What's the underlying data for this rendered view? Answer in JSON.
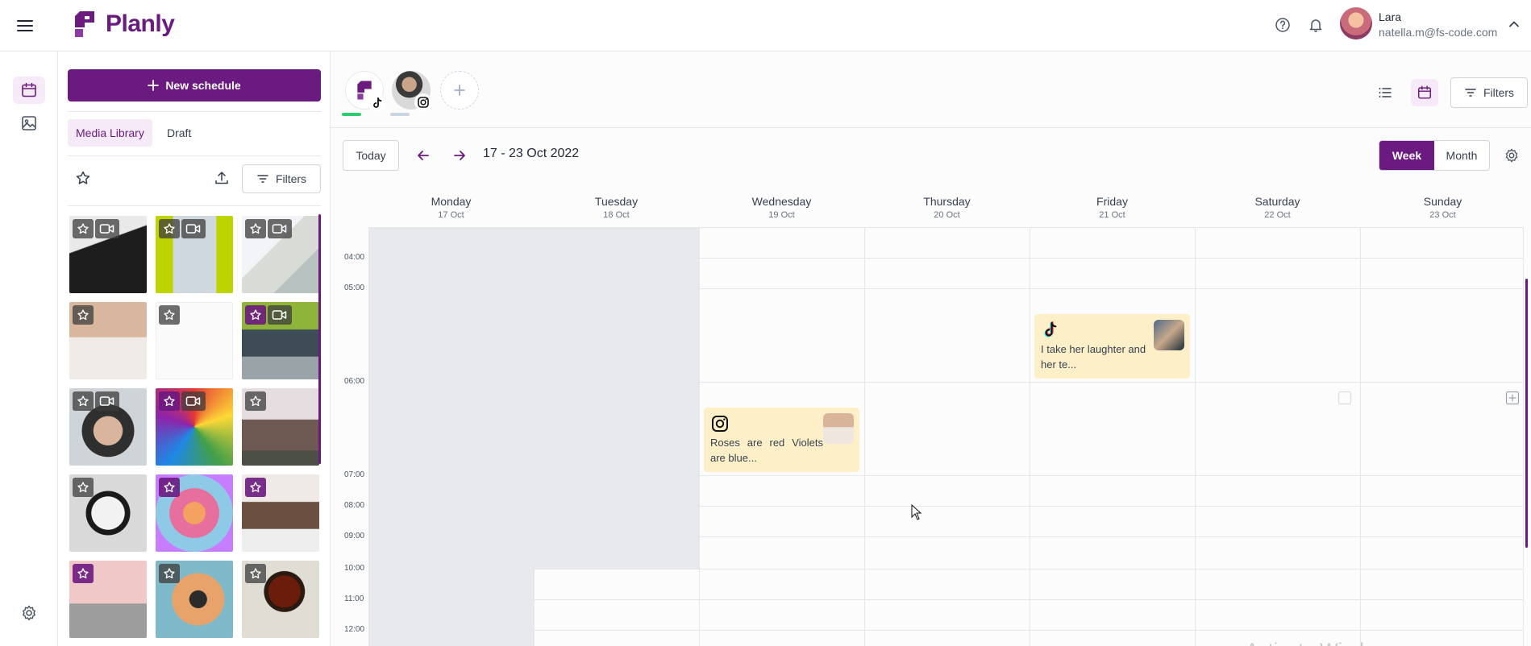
{
  "app": {
    "name": "Planly"
  },
  "user": {
    "name": "Lara",
    "email": "natella.m@fs-code.com"
  },
  "colors": {
    "brand": "#6b1a7f",
    "brand_light": "#f6eaf8",
    "post_bg": "#fdf0c8",
    "past_bg": "#e8e9ec"
  },
  "library": {
    "new_schedule_label": "New schedule",
    "tabs": [
      {
        "label": "Media Library",
        "active": true
      },
      {
        "label": "Draft",
        "active": false
      }
    ],
    "filters_label": "Filters",
    "items": [
      {
        "type": "video",
        "fav": false
      },
      {
        "type": "video",
        "fav": false
      },
      {
        "type": "video",
        "fav": false
      },
      {
        "type": "image",
        "fav": false
      },
      {
        "type": "image",
        "fav": false
      },
      {
        "type": "video",
        "fav": true
      },
      {
        "type": "video",
        "fav": false
      },
      {
        "type": "video",
        "fav": true
      },
      {
        "type": "image",
        "fav": false
      },
      {
        "type": "image",
        "fav": false
      },
      {
        "type": "image",
        "fav": true
      },
      {
        "type": "image",
        "fav": true
      },
      {
        "type": "image",
        "fav": true
      },
      {
        "type": "image",
        "fav": false
      },
      {
        "type": "image",
        "fav": false
      }
    ]
  },
  "toolbar": {
    "today_label": "Today",
    "range": "17 - 23 Oct 2022",
    "view_week": "Week",
    "view_month": "Month",
    "filters_label": "Filters"
  },
  "calendar": {
    "days": [
      {
        "name": "Monday",
        "date": "17 Oct"
      },
      {
        "name": "Tuesday",
        "date": "18 Oct"
      },
      {
        "name": "Wednesday",
        "date": "19 Oct"
      },
      {
        "name": "Thursday",
        "date": "20 Oct"
      },
      {
        "name": "Friday",
        "date": "21 Oct"
      },
      {
        "name": "Saturday",
        "date": "22 Oct"
      },
      {
        "name": "Sunday",
        "date": "23 Oct"
      }
    ],
    "hours": [
      "04:00",
      "05:00",
      "06:00",
      "07:00",
      "08:00",
      "09:00",
      "10:00",
      "11:00",
      "12:00"
    ],
    "posts": [
      {
        "network": "tiktok",
        "day": "Friday",
        "text": "I take her laughter and her te..."
      },
      {
        "network": "instagram",
        "day": "Wednesday",
        "text": "Roses are red Violets are blue..."
      }
    ]
  },
  "watermark": "Activate Windows"
}
